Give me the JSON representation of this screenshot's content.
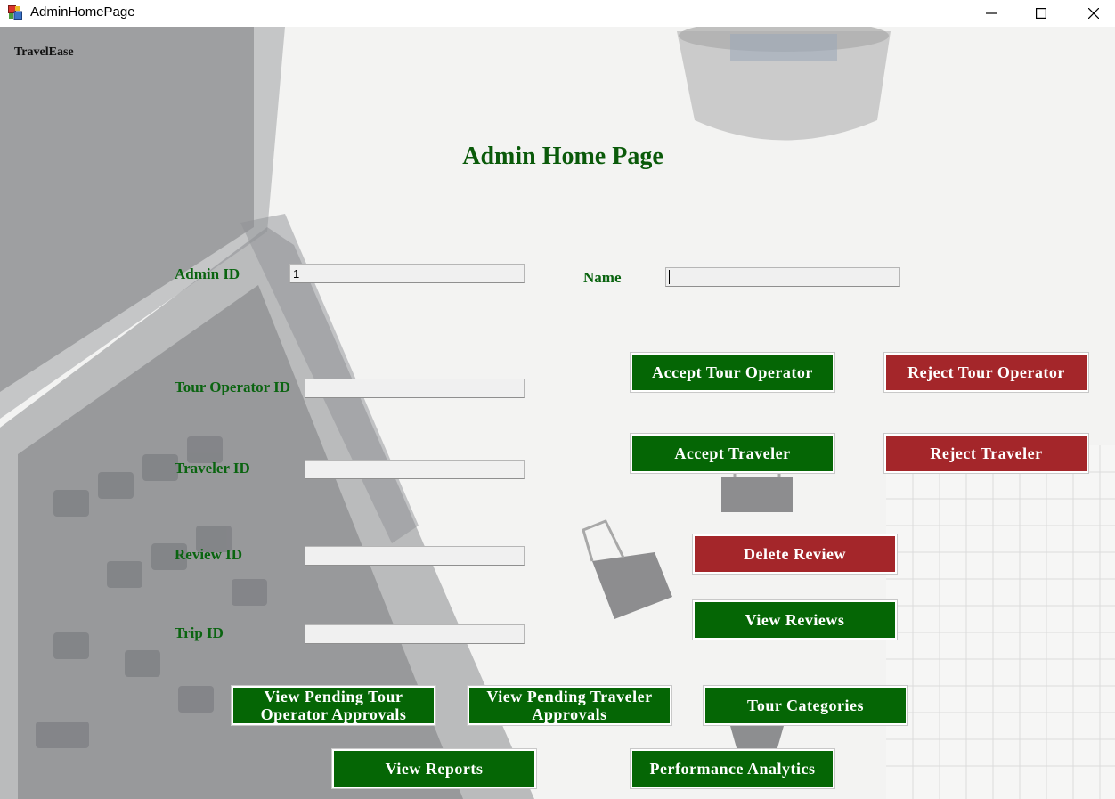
{
  "window": {
    "title": "AdminHomePage",
    "icons": {
      "app": "app-icon",
      "minimize": "minimize-icon",
      "maximize": "maximize-icon",
      "close": "close-icon"
    }
  },
  "brand": "TravelEase",
  "heading": "Admin Home Page",
  "fields": {
    "admin_id": {
      "label": "Admin ID",
      "value": "1"
    },
    "name": {
      "label": "Name",
      "value": ""
    },
    "tour_operator_id": {
      "label": "Tour Operator ID",
      "value": ""
    },
    "traveler_id": {
      "label": "Traveler ID",
      "value": ""
    },
    "review_id": {
      "label": "Review ID",
      "value": ""
    },
    "trip_id": {
      "label": "Trip ID",
      "value": ""
    }
  },
  "buttons": {
    "accept_tour_operator": "Accept Tour Operator",
    "reject_tour_operator": "Reject Tour Operator",
    "accept_traveler": "Accept Traveler",
    "reject_traveler": "Reject Traveler",
    "delete_review": "Delete Review",
    "view_reviews": "View Reviews",
    "view_pending_tour_operator_approvals": "View Pending Tour Operator Approvals",
    "view_pending_traveler_approvals": "View Pending Traveler Approvals",
    "tour_categories": "Tour Categories",
    "view_reports": "View Reports",
    "performance_analytics": "Performance Analytics"
  },
  "colors": {
    "accept": "#056605",
    "reject": "#a4262a",
    "label": "#0a6410",
    "heading": "#0a5a0a"
  }
}
